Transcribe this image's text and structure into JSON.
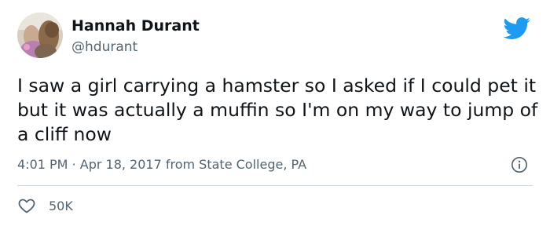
{
  "tweet": {
    "author_name": "Hannah Durant",
    "author_handle": "@hdurant",
    "text": "I saw a girl carrying a hamster so I asked if I could pet it but it was actually a muffin so I'm on my way to jump of a cliff now",
    "time": "4:01 PM",
    "separator": "·",
    "date": "Apr 18, 2017",
    "location": "from State College, PA",
    "likes": "50K"
  },
  "colors": {
    "brand_blue": "#1d9bf0",
    "secondary_text": "#536471",
    "primary_text": "#0f1419",
    "divider": "#cfd9de"
  },
  "icons": {
    "logo": "twitter-bird-icon",
    "info": "info-icon",
    "like": "heart-icon"
  }
}
